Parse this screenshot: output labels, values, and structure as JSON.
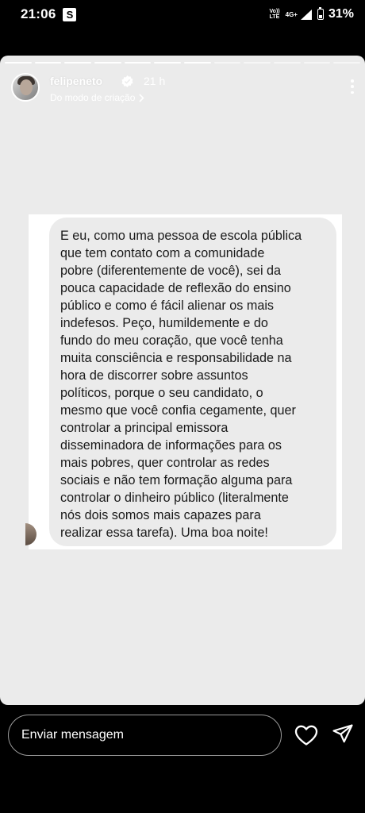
{
  "status_bar": {
    "time": "21:06",
    "app_badge": "S",
    "volte_top": "Vo))",
    "volte_bottom": "LTE",
    "network": "4G+",
    "battery_percent": 31,
    "battery_label": "31%"
  },
  "story": {
    "segments_total": 12,
    "segments_done": 7,
    "username": "felipeneto",
    "verified": true,
    "time_ago": "21 h",
    "sub_link": "Do modo de criação",
    "message": "E eu, como uma pessoa de escola pública\nque tem contato com a comunidade\npobre (diferentemente de você), sei da\npouca capacidade de reflexão do ensino\npúblico e como é fácil alienar os mais\nindefesos. Peço, humildemente e do\nfundo do meu coração, que você tenha\nmuita consciência e responsabilidade na\nhora de discorrer sobre assuntos\npolíticos, porque o seu candidato, o\nmesmo que você confia cegamente, quer\ncontrolar a principal emissora\ndisseminadora de informações para os\nmais pobres, quer controlar as redes\nsociais e não tem formação alguma para\ncontrolar o dinheiro público (literalmente\nnós dois somos mais capazes para\nrealizar essa tarefa). Uma boa noite!"
  },
  "reply": {
    "placeholder": "Enviar mensagem"
  },
  "icons": {
    "like": "heart-icon",
    "send": "send-icon",
    "more": "more-vertical-icon"
  },
  "colors": {
    "story_background": "#ebebeb",
    "bubble": "#ebebeb",
    "text": "#1a1a1a",
    "bar": "#000000"
  }
}
